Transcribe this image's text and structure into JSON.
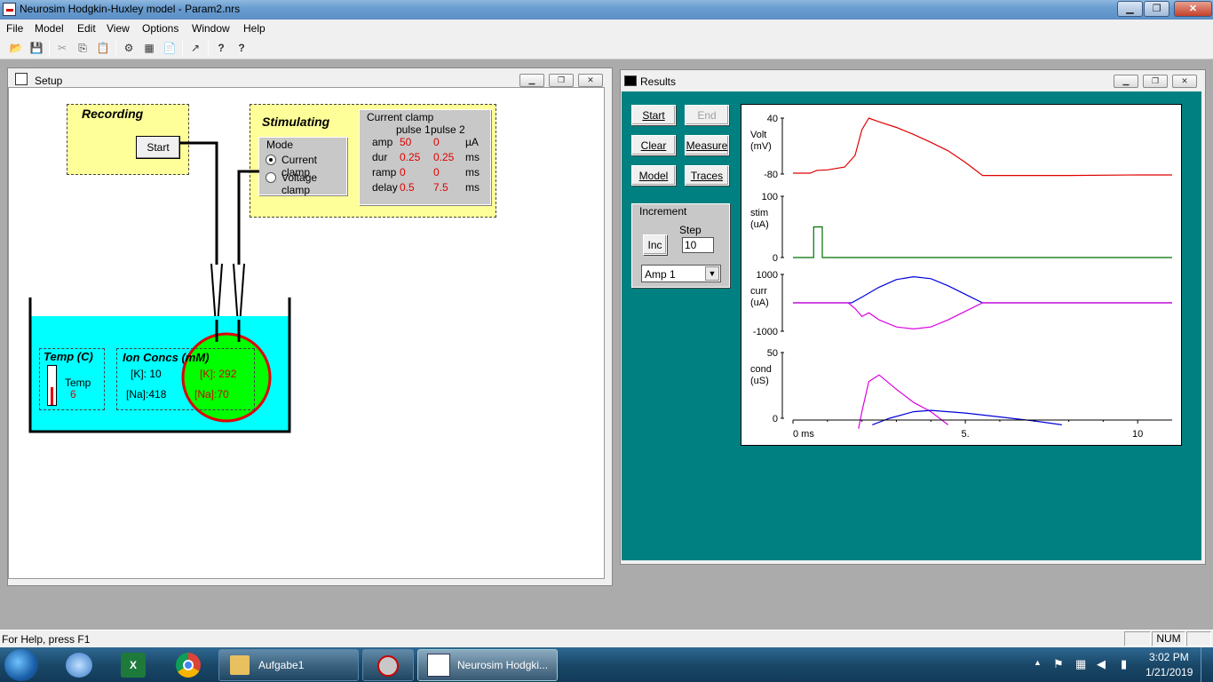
{
  "app": {
    "title": "Neurosim Hodgkin-Huxley model - Param2.nrs",
    "window_buttons": {
      "minimize": "▁",
      "maximize": "❐",
      "close": "✕"
    }
  },
  "menu": [
    "File",
    "Model",
    "Edit",
    "View",
    "Options",
    "Window",
    "Help"
  ],
  "toolbar": {
    "icons": [
      "open-folder-icon",
      "save-icon",
      "cut-icon",
      "copy-icon",
      "paste-icon",
      "model-icon",
      "grid-icon",
      "clipboard-icon",
      "graph-icon",
      "help-icon",
      "context-help-icon"
    ],
    "glyphs": [
      "📂",
      "💾",
      "✂",
      "⎘",
      "📋",
      "⚙",
      "▦",
      "📄",
      "↗",
      "?",
      "?"
    ]
  },
  "setup": {
    "title": "Setup",
    "recording": {
      "label": "Recording",
      "start": "Start"
    },
    "stimulating": {
      "label": "Stimulating",
      "mode_label": "Mode",
      "modes": [
        "Current clamp",
        "Voltage clamp"
      ],
      "selected_mode": "Current clamp",
      "current_clamp": {
        "label": "Current clamp",
        "col1": "pulse 1",
        "col2": "pulse 2",
        "rows": [
          {
            "name": "amp",
            "p1": "50",
            "p2": "0",
            "unit": "µA"
          },
          {
            "name": "dur",
            "p1": "0.25",
            "p2": "0.25",
            "unit": "ms"
          },
          {
            "name": "ramp",
            "p1": "0",
            "p2": "0",
            "unit": "ms"
          },
          {
            "name": "delay",
            "p1": "0.5",
            "p2": "7.5",
            "unit": "ms"
          }
        ]
      }
    },
    "temp": {
      "label": "Temp (C)",
      "name": "Temp",
      "value": "6"
    },
    "ions": {
      "label": "Ion Concs (mM)",
      "k_out": "[K]: 10",
      "na_out": "[Na]:418",
      "k_in": "[K]: 292",
      "na_in": "[Na]:70"
    }
  },
  "results": {
    "title": "Results",
    "buttons": {
      "start": "Start",
      "end": "End",
      "clear": "Clear",
      "measure": "Measure",
      "model": "Model",
      "traces": "Traces"
    },
    "increment": {
      "label": "Increment",
      "inc": "Inc",
      "step_label": "Step",
      "step_value": "10",
      "select_value": "Amp 1"
    }
  },
  "chart_data": {
    "type": "line",
    "x_ticks": [
      "0 ms",
      "5.",
      "10"
    ],
    "xlim": [
      0,
      11
    ],
    "panels": [
      {
        "ylabel": [
          "Volt",
          "(mV)"
        ],
        "top_tick": "40",
        "bottom_tick": "-80",
        "ylim": [
          -80,
          40
        ],
        "series": [
          {
            "color": "#e00000",
            "x": [
              0,
              0.5,
              0.7,
              1.0,
              1.5,
              1.8,
              2.0,
              2.2,
              2.5,
              3.0,
              3.5,
              4.0,
              4.5,
              5.0,
              5.5,
              6.5,
              8.0,
              10.0,
              11.0
            ],
            "y": [
              -78,
              -78,
              -72,
              -71,
              -65,
              -40,
              15,
              40,
              32,
              20,
              5,
              -12,
              -30,
              -55,
              -83,
              -83,
              -83,
              -82,
              -82
            ]
          }
        ]
      },
      {
        "ylabel": [
          "stim",
          "(uA)"
        ],
        "top_tick": "100",
        "bottom_tick": "0",
        "ylim": [
          0,
          100
        ],
        "series": [
          {
            "color": "#007000",
            "x": [
              0,
              0.6,
              0.6,
              0.85,
              0.85,
              11
            ],
            "y": [
              0,
              0,
              50,
              50,
              0,
              0
            ]
          }
        ]
      },
      {
        "ylabel": [
          "curr",
          "(uA)"
        ],
        "top_tick": "1000",
        "bottom_tick": "-1000",
        "ylim": [
          -1000,
          1000
        ],
        "series": [
          {
            "color": "#0000dd",
            "x": [
              0,
              1.7,
              2.0,
              2.5,
              3.0,
              3.5,
              4.0,
              4.5,
              5.0,
              5.5,
              11
            ],
            "y": [
              0,
              0,
              200,
              550,
              820,
              920,
              850,
              600,
              300,
              0,
              0
            ]
          },
          {
            "color": "#dd00dd",
            "x": [
              0,
              1.6,
              1.8,
              2.0,
              2.2,
              2.5,
              3.0,
              3.5,
              4.0,
              4.5,
              5.0,
              5.5,
              11
            ],
            "y": [
              0,
              0,
              -200,
              -480,
              -350,
              -600,
              -850,
              -920,
              -850,
              -600,
              -300,
              0,
              0
            ]
          }
        ]
      },
      {
        "ylabel": [
          "cond",
          "(uS)"
        ],
        "top_tick": "50",
        "bottom_tick": "0",
        "ylim": [
          0,
          50
        ],
        "series": [
          {
            "color": "#dd00dd",
            "x": [
              1.9,
              2.0,
              2.2,
              2.5,
              3.0,
              3.5,
              4.0,
              4.5
            ],
            "y": [
              -8,
              5,
              28,
              33,
              22,
              12,
              5,
              -5
            ]
          },
          {
            "color": "#0000dd",
            "x": [
              2.3,
              2.8,
              3.5,
              4.0,
              5.0,
              6.0,
              7.0,
              7.8
            ],
            "y": [
              -5,
              0,
              5,
              6,
              4,
              1,
              -2,
              -5
            ]
          }
        ]
      }
    ]
  },
  "status": {
    "help": "For Help, press F1",
    "num": "NUM"
  },
  "taskbar": {
    "items": [
      "Aufgabe1",
      "Neurosim Hodgki..."
    ],
    "time": "3:02 PM",
    "date": "1/21/2019"
  }
}
